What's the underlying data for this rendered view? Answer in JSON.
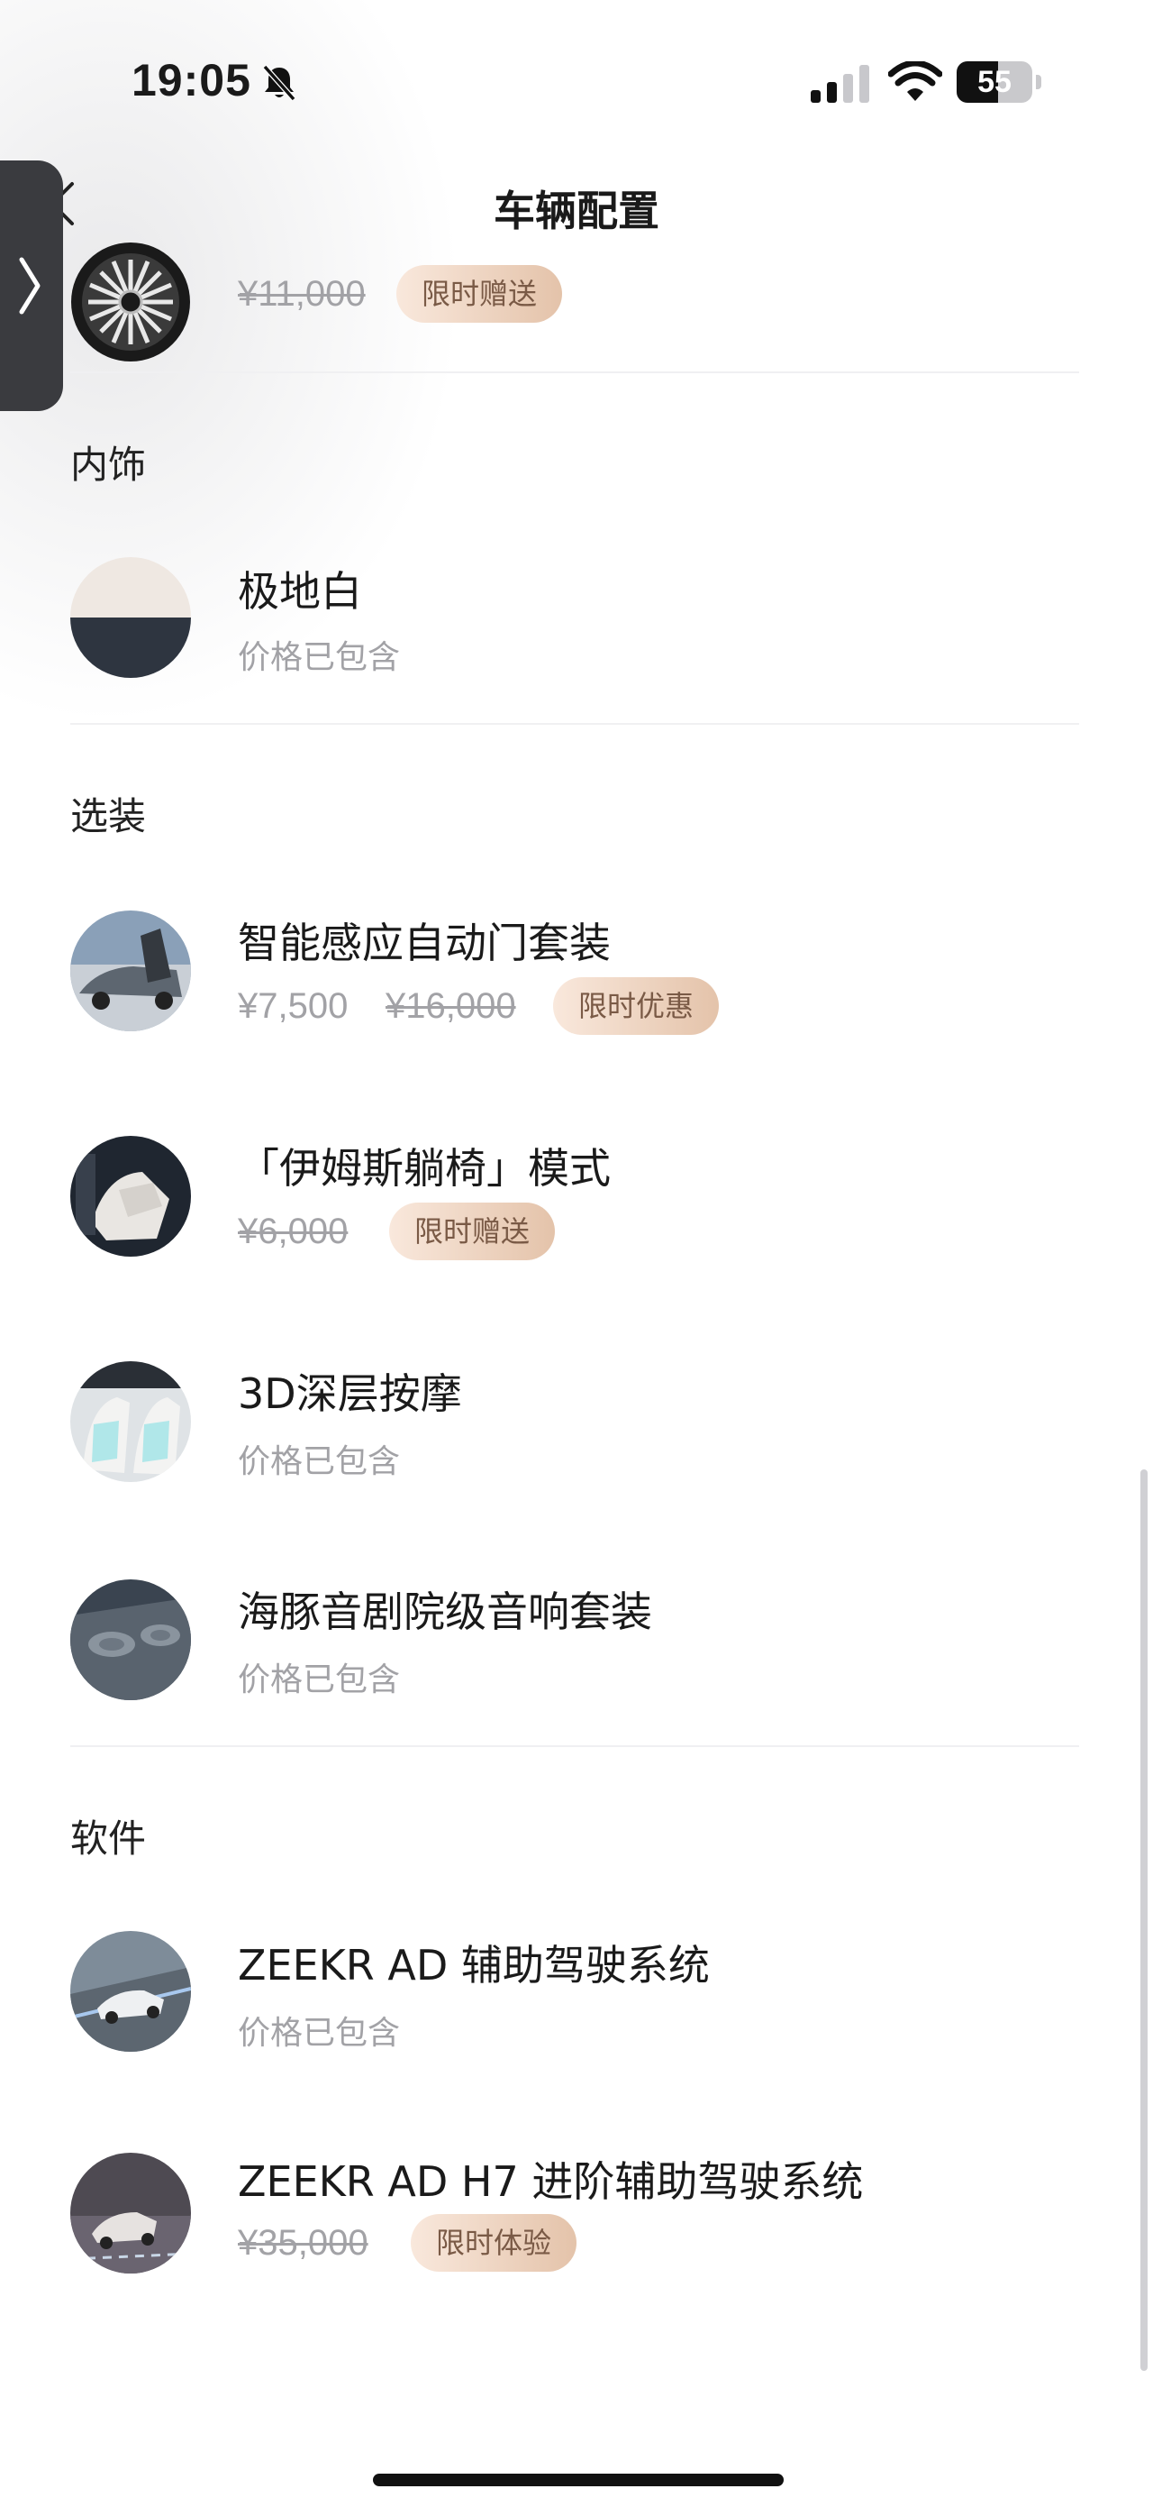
{
  "status_bar": {
    "time": "19:05",
    "battery": "55",
    "battery_level": 0.55
  },
  "nav": {
    "title": "车辆配置"
  },
  "wheel": {
    "original_price": "¥11,000",
    "badge": "限时赠送"
  },
  "interior": {
    "section_title": "内饰",
    "item": {
      "name": "极地白",
      "price_note": "价格已包含"
    }
  },
  "options": {
    "section_title": "选装",
    "items": [
      {
        "name": "智能感应自动门套装",
        "price": "¥7,500",
        "original_price": "¥16,000",
        "badge": "限时优惠"
      },
      {
        "name": "「伊姆斯躺椅」模式",
        "original_price": "¥6,000",
        "badge": "限时赠送"
      },
      {
        "name": "3D深层按摩",
        "price_note": "价格已包含"
      },
      {
        "name": "海豚音剧院级音响套装",
        "price_note": "价格已包含"
      }
    ]
  },
  "software": {
    "section_title": "软件",
    "items": [
      {
        "name": "ZEEKR AD 辅助驾驶系统",
        "price_note": "价格已包含"
      },
      {
        "name": "ZEEKR AD H7 进阶辅助驾驶系统",
        "original_price": "¥35,000",
        "badge": "限时体验"
      }
    ]
  }
}
